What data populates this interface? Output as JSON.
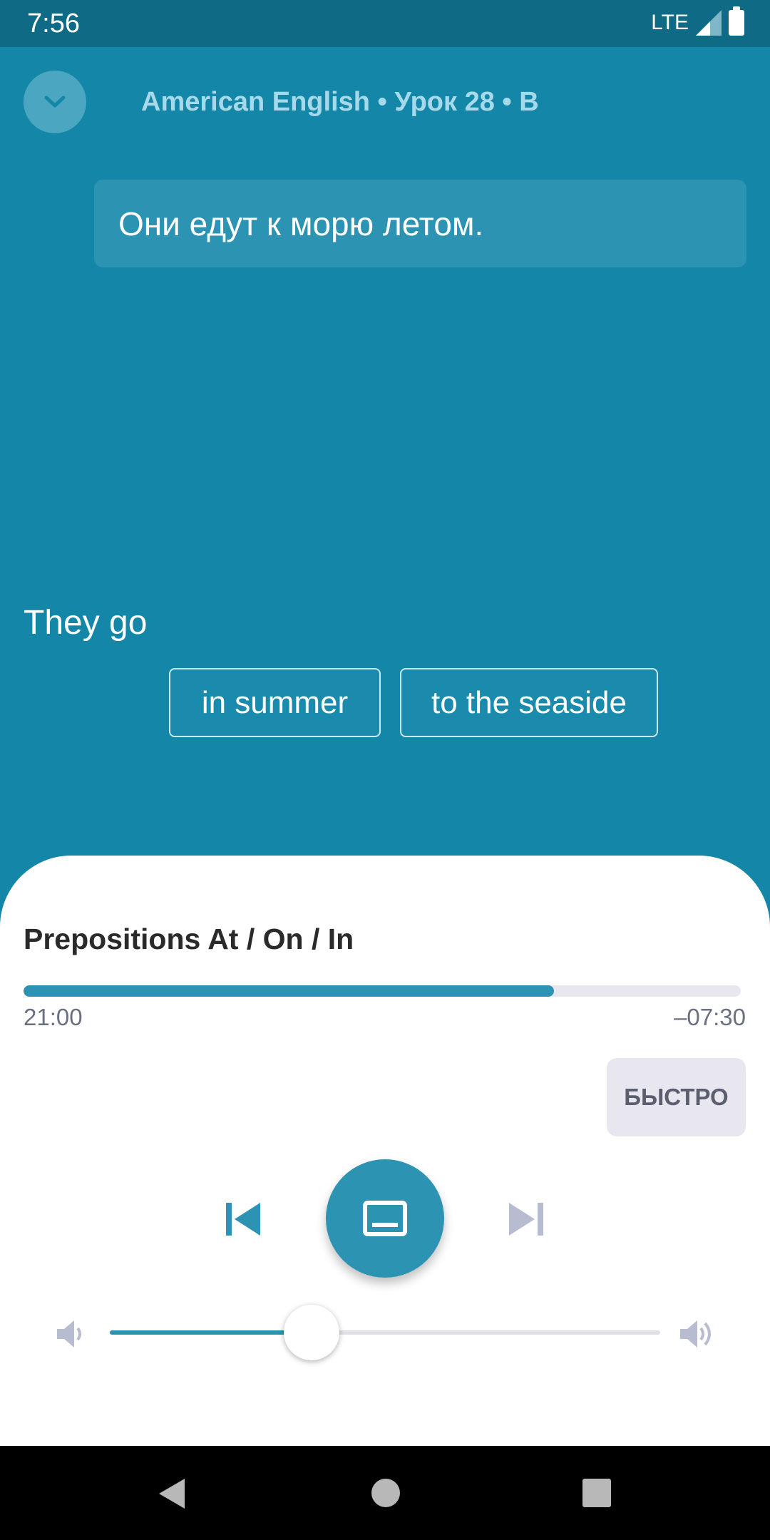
{
  "status_bar": {
    "time": "7:56",
    "network": "LTE",
    "icons": [
      "signal-icon",
      "battery-icon"
    ]
  },
  "header": {
    "collapse_icon": "chevron-down-icon",
    "lesson_title": "American English • Урок 28 • B"
  },
  "exercise": {
    "prompt": "Они едут к морю летом.",
    "answer_start": "They go",
    "chips": [
      {
        "label": "in summer"
      },
      {
        "label": "to the seaside"
      }
    ]
  },
  "player": {
    "track_title": "Prepositions At / On / In",
    "progress_fraction": 0.74,
    "elapsed": "21:00",
    "remaining": "–07:30",
    "speed_label": "БЫСТРО",
    "controls": {
      "prev_icon": "skip-previous-icon",
      "main_icon": "subtitles-icon",
      "next_icon": "skip-next-icon"
    },
    "volume_fraction": 0.367,
    "volume_icons": [
      "volume-low-icon",
      "volume-high-icon"
    ]
  },
  "colors": {
    "background": "#1487a8",
    "status_bar": "#0f6a86",
    "accent": "#2c93b3",
    "bubble": "#2c93b3",
    "disabled_icon": "#b8bcd0"
  }
}
